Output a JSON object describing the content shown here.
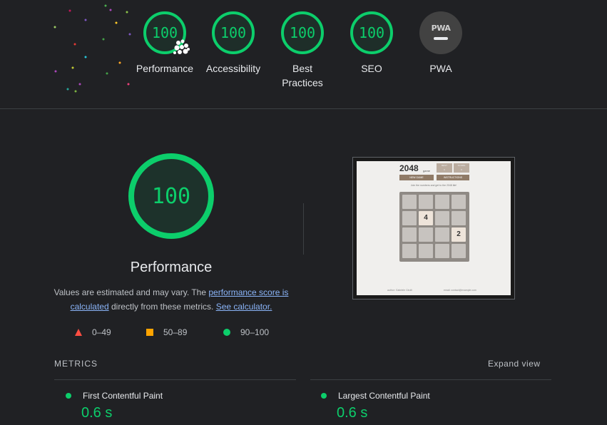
{
  "colors": {
    "pass": "#0cce6b",
    "average": "#ffa400",
    "fail": "#ff4e42",
    "background": "#202124",
    "link": "#8ab4f8"
  },
  "categories": [
    {
      "name": "performance",
      "score": "100",
      "label": "Performance"
    },
    {
      "name": "accessibility",
      "score": "100",
      "label": "Accessibility"
    },
    {
      "name": "best-practices",
      "score": "100",
      "label": "Best Practices"
    },
    {
      "name": "seo",
      "score": "100",
      "label": "SEO"
    },
    {
      "name": "pwa",
      "badge": "PWA",
      "label": "PWA",
      "icon": "pwa-dash-icon"
    }
  ],
  "main": {
    "score": "100",
    "title": "Performance",
    "desc_prefix": "Values are estimated and may vary. The ",
    "desc_link": "performance score is calculated",
    "desc_mid": " directly from these metrics. ",
    "calc_link": "See calculator."
  },
  "legend": [
    {
      "range": "0–49",
      "icon": "triangle-icon"
    },
    {
      "range": "50–89",
      "icon": "square-icon"
    },
    {
      "range": "90–100",
      "icon": "circle-icon"
    }
  ],
  "screenshot": {
    "game_title": "2048",
    "game_sub": "game",
    "best_label": "BEST",
    "best_value": "0",
    "score_label": "SCORE",
    "score_value": "0",
    "new_game": "NEW GAME",
    "instructions": "INSTRUCTIONS",
    "intro": "Join the numbers and get to the 2048 tile!",
    "tile_a": "4",
    "tile_b": "2",
    "footer_left": "author: Gabriele Cirulli",
    "footer_right": "email: contact@example.com"
  },
  "metrics": {
    "title": "METRICS",
    "expand": "Expand view",
    "items": [
      {
        "label": "First Contentful Paint",
        "value": "0.6 s"
      },
      {
        "label": "Largest Contentful Paint",
        "value": "0.6 s"
      }
    ]
  }
}
